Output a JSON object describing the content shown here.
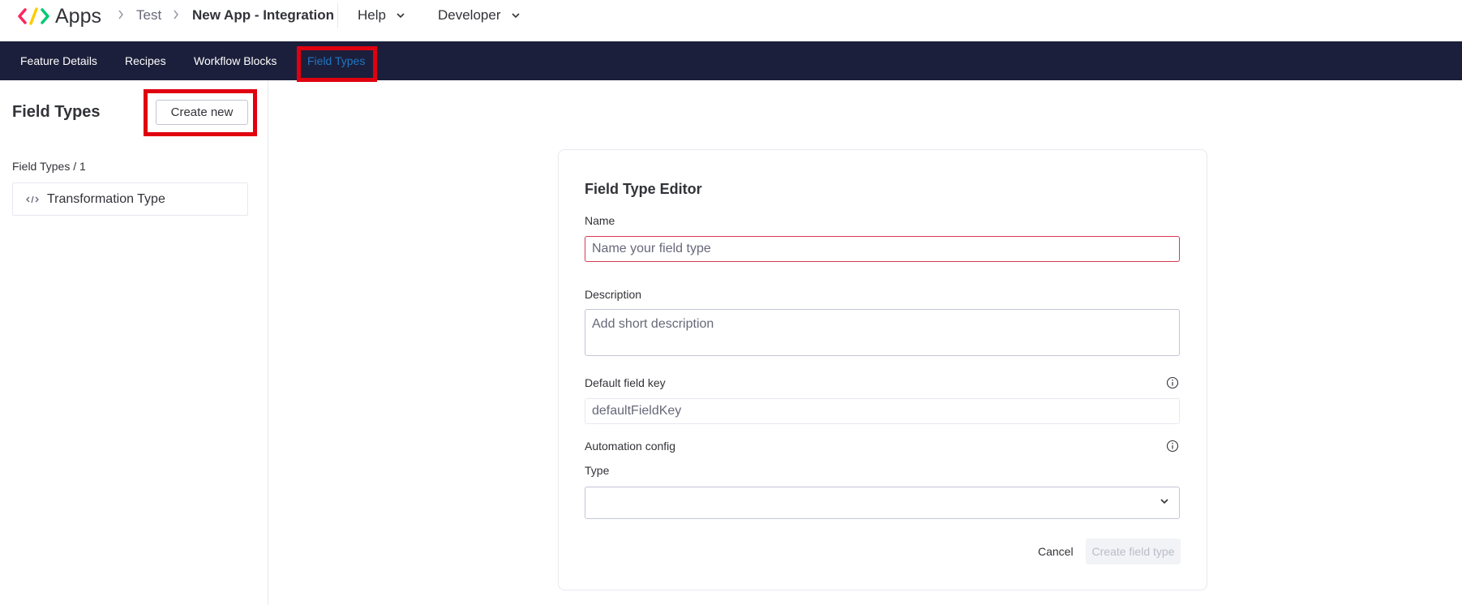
{
  "header": {
    "app_name": "Apps",
    "breadcrumb": [
      "Test",
      "New App - Integration"
    ],
    "menus": [
      {
        "label": "Help",
        "icon": "chevron-down-icon"
      },
      {
        "label": "Developer",
        "icon": "chevron-down-icon"
      }
    ],
    "logo_colors": [
      "#fb275d",
      "#ffcc00",
      "#00ca72"
    ]
  },
  "nav": {
    "tabs": [
      {
        "label": "Feature Details"
      },
      {
        "label": "Recipes"
      },
      {
        "label": "Workflow Blocks"
      },
      {
        "label": "Field Types",
        "active": true
      }
    ]
  },
  "sidebar": {
    "title": "Field Types",
    "create_button": "Create new",
    "breadcrumb": "Field Types / 1",
    "items": [
      {
        "label": "Transformation Type",
        "icon": "code-icon"
      }
    ]
  },
  "editor": {
    "title": "Field Type Editor",
    "name_label": "Name",
    "name_placeholder": "Name your field type",
    "name_value": "",
    "description_label": "Description",
    "description_placeholder": "Add short description",
    "description_value": "",
    "default_key_label": "Default field key",
    "default_key_placeholder": "defaultFieldKey",
    "default_key_value": "",
    "automation_label": "Automation config",
    "type_label": "Type",
    "type_value": "",
    "cancel_button": "Cancel",
    "create_button": "Create field type"
  },
  "colors": {
    "nav_bg": "#1c1f3b",
    "active_tab": "#1f76c2",
    "highlight": "#e0000f",
    "error_border": "#d83a52"
  }
}
